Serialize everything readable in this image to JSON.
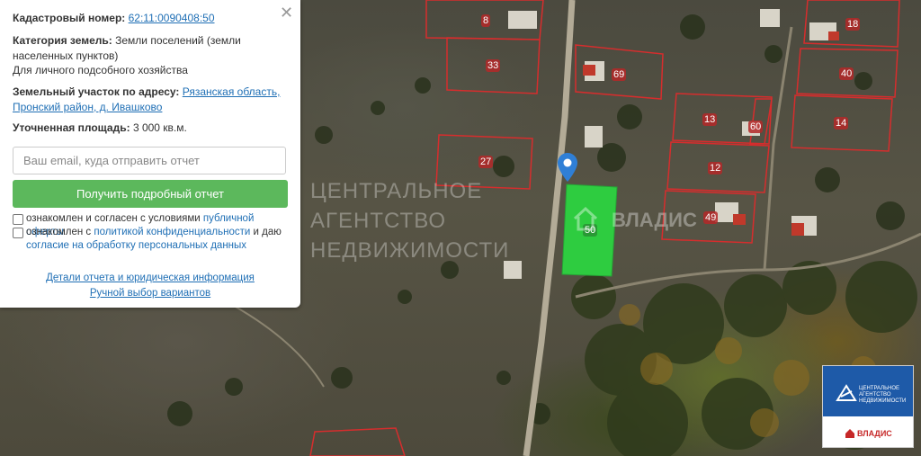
{
  "panel": {
    "close_icon": "close-icon",
    "cadastral_label": "Кадастровый номер:",
    "cadastral_number": "62:11:0090408:50",
    "category_label": "Категория земель:",
    "category_value_1": "Земли поселений (земли",
    "category_value_2": "населенных пунктов)",
    "category_value_3": "Для личного подсобного хозяйства",
    "address_label": "Земельный участок по адресу:",
    "address_part_1": "Рязанская область,",
    "address_part_2": "Пронский район, д. Ивашково",
    "area_label": "Уточненная площадь:",
    "area_value": "3 000 кв.м.",
    "email_placeholder": "Ваш email, куда отправить отчет",
    "email_value": "",
    "get_report_button": "Получить подробный отчет",
    "consent_1_text": "ознакомлен и согласен с условиями",
    "consent_1_link": "публичной оферты",
    "consent_2_text": "ознакомлен с",
    "consent_2_link_a": "политикой конфиденциальности",
    "consent_2_mid": "и даю",
    "consent_2_link_b": "согласие на обработку персональных данных",
    "details_link": "Детали отчета и юридическая информация",
    "manual_link": "Ручной выбор вариантов"
  },
  "map": {
    "plots": [
      "8",
      "33",
      "69",
      "18",
      "40",
      "14",
      "13",
      "60",
      "12",
      "27",
      "49",
      "50"
    ],
    "watermark_lines": [
      "ЦЕНТРАЛЬНОЕ",
      "АГЕНТСТВО",
      "НЕДВИЖИМОСТИ"
    ],
    "watermark_brand": "ВЛАДИС",
    "selected_plot_color": "#2ecc40",
    "border_color": "#d62d2d"
  },
  "brand": {
    "lines": [
      "ЦЕНТРАЛЬНОЕ",
      "АГЕНТСТВО",
      "НЕДВИЖИМОСТИ"
    ],
    "name": "ВЛАДИС",
    "color": "#1e5aa8"
  }
}
